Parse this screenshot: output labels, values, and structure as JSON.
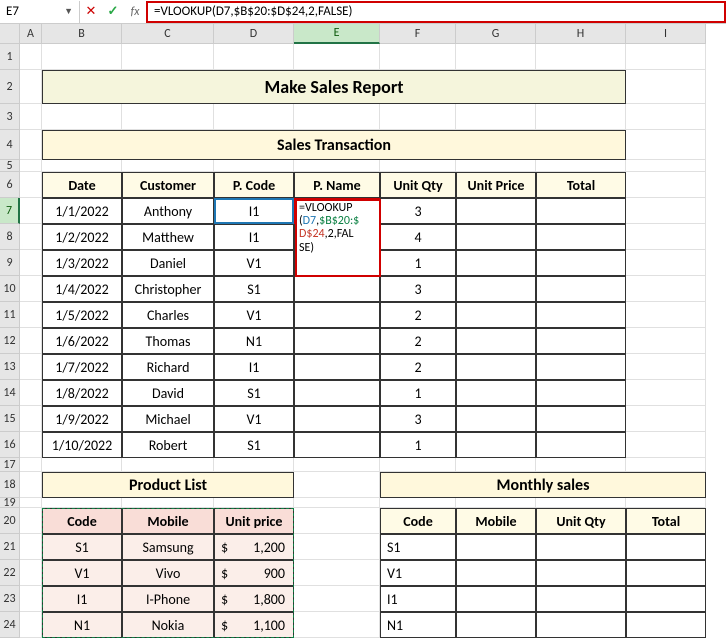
{
  "name_box": "E7",
  "formula_bar": "=VLOOKUP(D7,$B$20:$D$24,2,FALSE)",
  "formula_edit": {
    "l1": "=VLOOKUP",
    "l2a": "(",
    "l2b": "D7",
    "l2c": ",",
    "l2d": "$B$20:$",
    "l3": "D$24",
    "l3b": ",2,FAL",
    "l4": "SE)"
  },
  "columns": [
    "A",
    "B",
    "C",
    "D",
    "E",
    "F",
    "G",
    "H",
    "I"
  ],
  "rows": [
    "1",
    "2",
    "3",
    "4",
    "5",
    "6",
    "7",
    "8",
    "9",
    "10",
    "11",
    "12",
    "13",
    "14",
    "15",
    "16",
    "17",
    "18",
    "19",
    "20",
    "21",
    "22",
    "23",
    "24"
  ],
  "titles": {
    "main": "Make Sales Report",
    "trans": "Sales Transaction",
    "prod": "Product List",
    "monthly": "Monthly sales"
  },
  "trans_headers": [
    "Date",
    "Customer",
    "P. Code",
    "P. Name",
    "Unit Qty",
    "Unit Price",
    "Total"
  ],
  "trans_rows": [
    {
      "date": "1/1/2022",
      "cust": "Anthony",
      "code": "I1",
      "qty": "3"
    },
    {
      "date": "1/2/2022",
      "cust": "Matthew",
      "code": "I1",
      "qty": "4"
    },
    {
      "date": "1/3/2022",
      "cust": "Daniel",
      "code": "V1",
      "qty": "1"
    },
    {
      "date": "1/4/2022",
      "cust": "Christopher",
      "code": "S1",
      "qty": "3"
    },
    {
      "date": "1/5/2022",
      "cust": "Charles",
      "code": "V1",
      "qty": "2"
    },
    {
      "date": "1/6/2022",
      "cust": "Thomas",
      "code": "N1",
      "qty": "2"
    },
    {
      "date": "1/7/2022",
      "cust": "Richard",
      "code": "I1",
      "qty": "2"
    },
    {
      "date": "1/8/2022",
      "cust": "David",
      "code": "S1",
      "qty": "1"
    },
    {
      "date": "1/9/2022",
      "cust": "Michael",
      "code": "V1",
      "qty": "3"
    },
    {
      "date": "1/10/2022",
      "cust": "Robert",
      "code": "S1",
      "qty": "1"
    }
  ],
  "prod_headers": [
    "Code",
    "Mobile",
    "Unit price"
  ],
  "prod_rows": [
    {
      "code": "S1",
      "mobile": "Samsung",
      "cur": "$",
      "price": "1,200"
    },
    {
      "code": "V1",
      "mobile": "Vivo",
      "cur": "$",
      "price": "900"
    },
    {
      "code": "I1",
      "mobile": "I-Phone",
      "cur": "$",
      "price": "1,800"
    },
    {
      "code": "N1",
      "mobile": "Nokia",
      "cur": "$",
      "price": "1,100"
    }
  ],
  "monthly_headers": [
    "Code",
    "Mobile",
    "Unit Qty",
    "Total"
  ],
  "monthly_rows": [
    {
      "code": "S1"
    },
    {
      "code": "V1"
    },
    {
      "code": "I1"
    },
    {
      "code": "N1"
    }
  ]
}
